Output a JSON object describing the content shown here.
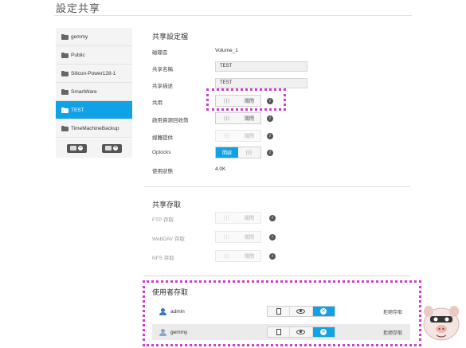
{
  "page": {
    "title": "設定共享"
  },
  "shares": [
    {
      "name": "gemmy",
      "active": false
    },
    {
      "name": "Public",
      "active": false
    },
    {
      "name": "Silicon-Power128-1",
      "active": false
    },
    {
      "name": "SmartWare",
      "active": false
    },
    {
      "name": "TEST",
      "active": true
    },
    {
      "name": "TimeMachineBackup",
      "active": false
    }
  ],
  "list_actions": {
    "remove_symbol": "−",
    "add_symbol": "+"
  },
  "share_profile": {
    "title": "共享設定檔",
    "volume": {
      "label": "磁碟區",
      "value": "Volume_1"
    },
    "share_name": {
      "label": "共享名稱",
      "value": "TEST"
    },
    "share_desc": {
      "label": "共享描述",
      "value": "TEST"
    },
    "public": {
      "label": "共用",
      "state": "關閉",
      "grip": "|||"
    },
    "recycle_bin": {
      "label": "啟用資源回收筒",
      "state": "關閉",
      "grip": "|||"
    },
    "media_serving": {
      "label": "媒體提供",
      "state": "關閉",
      "grip": "|||"
    },
    "oplocks": {
      "label": "Oplocks",
      "state": "開啟",
      "grip": "|||"
    },
    "usage": {
      "label": "使用狀態",
      "value": "4.0K"
    }
  },
  "share_access": {
    "title": "共享存取",
    "ftp": {
      "label": "FTP 存取",
      "state": "關閉",
      "grip": "|||"
    },
    "webdav": {
      "label": "WebDAV 存取",
      "state": "關閉",
      "grip": "|||"
    },
    "nfs": {
      "label": "NFS 存取",
      "state": "關閉",
      "grip": "|||"
    }
  },
  "user_access": {
    "title": "使用者存取",
    "users": [
      {
        "name": "admin",
        "status": "拒絕存取",
        "selected_permission": "deny"
      },
      {
        "name": "gemmy",
        "status": "拒絕存取",
        "selected_permission": "deny"
      }
    ],
    "deny_symbol": "✕"
  },
  "info_symbol": "i",
  "colors": {
    "accent": "#11a1e6",
    "highlight": "#d43bd2"
  }
}
